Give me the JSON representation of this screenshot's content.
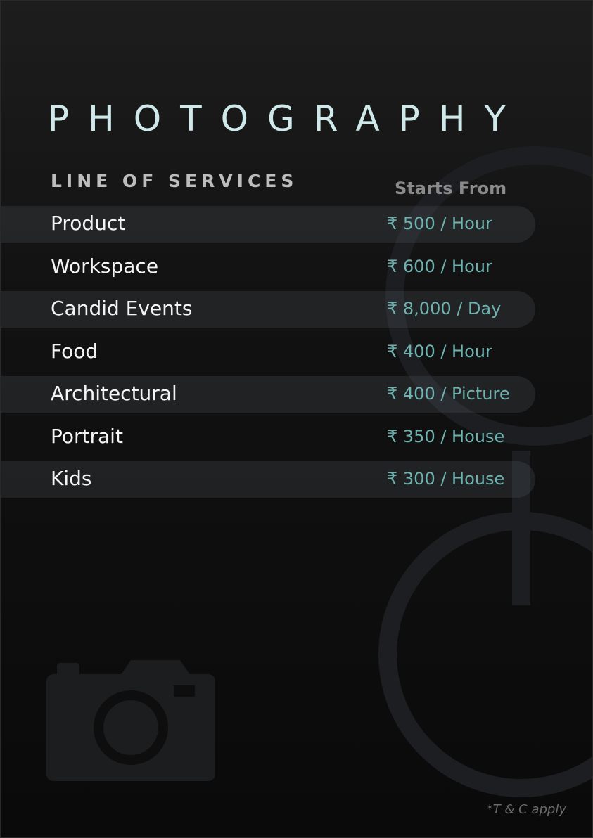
{
  "header": {
    "title": "PHOTOGRAPHY",
    "subtitle": "LINE OF SERVICES",
    "price_header": "Starts From"
  },
  "services": [
    {
      "name": "Product",
      "price": "₹ 500 / Hour"
    },
    {
      "name": "Workspace",
      "price": "₹ 600 / Hour"
    },
    {
      "name": "Candid Events",
      "price": "₹ 8,000 / Day"
    },
    {
      "name": "Food",
      "price": "₹ 400 / Hour"
    },
    {
      "name": "Architectural",
      "price": "₹ 400 / Picture"
    },
    {
      "name": "Portrait",
      "price": "₹ 350 / House"
    },
    {
      "name": "Kids",
      "price": "₹ 300 / House"
    }
  ],
  "footer": {
    "terms": "*T & C apply"
  },
  "icons": [
    "camera-icon",
    "lens-decoration-icon"
  ],
  "colors": {
    "title": "#cfe9ea",
    "price": "#6fb3b0",
    "background": "#121212",
    "band": "#2a3136"
  }
}
